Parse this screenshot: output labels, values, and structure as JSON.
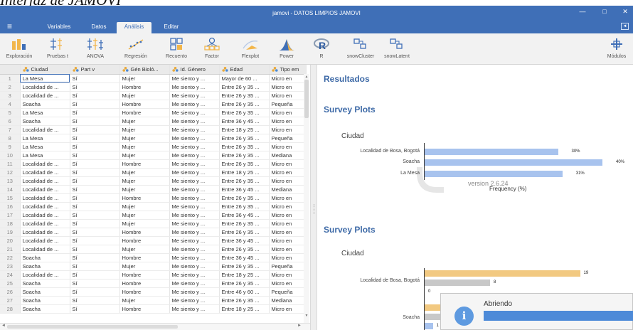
{
  "caption": "Interfaz de JAMOVI",
  "window": {
    "title": "jamovi - DATOS LIMPIOS JAMOVI",
    "minimize_glyph": "—",
    "maximize_glyph": "□",
    "close_glyph": "✕"
  },
  "menubar": {
    "menu_glyph": "≡",
    "tabs": [
      {
        "label": "Variables"
      },
      {
        "label": "Datos"
      },
      {
        "label": "Análisis"
      },
      {
        "label": "Editar"
      }
    ],
    "active_tab": "Análisis",
    "collapse_glyph": "◄"
  },
  "ribbon": {
    "buttons": [
      {
        "label": "Exploración",
        "icon": "exploration-icon"
      },
      {
        "label": "Pruebas t",
        "icon": "t-tests-icon"
      },
      {
        "label": "ANOVA",
        "icon": "anova-icon"
      },
      {
        "label": "Regresión",
        "icon": "regression-icon"
      },
      {
        "label": "Recuento",
        "icon": "frequencies-icon"
      },
      {
        "label": "Factor",
        "icon": "factor-icon"
      },
      {
        "label": "Flexplot",
        "icon": "flexplot-icon"
      },
      {
        "label": "Power",
        "icon": "power-icon"
      },
      {
        "label": "R",
        "icon": "r-icon"
      },
      {
        "label": "snowCluster",
        "icon": "snowcluster-icon"
      },
      {
        "label": "snowLatent",
        "icon": "snowlatent-icon"
      },
      {
        "label": "Módulos",
        "icon": "modules-icon"
      }
    ]
  },
  "colors": {
    "brand": "#3f6fb7",
    "bar_blue": "#a8c3ee",
    "bar_orange": "#f2c981",
    "bar_gray": "#c8c8c8",
    "header_blue": "#3e6aa7"
  },
  "table": {
    "columns": [
      "Ciudad",
      "Part v",
      "Gén Bioló...",
      "Id. Género",
      "Edad",
      "Tipo em"
    ],
    "rows": [
      {
        "n": "1",
        "cells": [
          "La Mesa",
          "Sí",
          "Mujer",
          "Me siento y ...",
          "Mayor de 60 ...",
          "Micro en"
        ]
      },
      {
        "n": "2",
        "cells": [
          "Localidad de ...",
          "Sí",
          "Hombre",
          "Me siento y ...",
          "Entre 26 y 35 ...",
          "Micro en"
        ]
      },
      {
        "n": "3",
        "cells": [
          "Localidad de ...",
          "Sí",
          "Mujer",
          "Me siento y ...",
          "Entre 26 y 35 ...",
          "Micro en"
        ]
      },
      {
        "n": "4",
        "cells": [
          "Soacha",
          "Sí",
          "Hombre",
          "Me siento y ...",
          "Entre 26 y 35 ...",
          "Pequeña"
        ]
      },
      {
        "n": "5",
        "cells": [
          "La Mesa",
          "Sí",
          "Hombre",
          "Me siento y ...",
          "Entre 26 y 35 ...",
          "Micro en"
        ]
      },
      {
        "n": "6",
        "cells": [
          "Soacha",
          "Sí",
          "Mujer",
          "Me siento y ...",
          "Entre 36 y 45 ...",
          "Micro en"
        ]
      },
      {
        "n": "7",
        "cells": [
          "Localidad de ...",
          "Sí",
          "Mujer",
          "Me siento y ...",
          "Entre 18 y 25 ...",
          "Micro en"
        ]
      },
      {
        "n": "8",
        "cells": [
          "La Mesa",
          "Sí",
          "Mujer",
          "Me siento y ...",
          "Entre 26 y 35 ...",
          "Pequeña"
        ]
      },
      {
        "n": "9",
        "cells": [
          "La Mesa",
          "Sí",
          "Mujer",
          "Me siento y ...",
          "Entre 26 y 35 ...",
          "Micro en"
        ]
      },
      {
        "n": "10",
        "cells": [
          "La Mesa",
          "Sí",
          "Mujer",
          "Me siento y ...",
          "Entre 26 y 35 ...",
          "Mediana"
        ]
      },
      {
        "n": "11",
        "cells": [
          "Localidad de ...",
          "Sí",
          "Hombre",
          "Me siento y ...",
          "Entre 26 y 35 ...",
          "Micro en"
        ]
      },
      {
        "n": "12",
        "cells": [
          "Localidad de ...",
          "Sí",
          "Mujer",
          "Me siento y ...",
          "Entre 18 y 25 ...",
          "Micro en"
        ]
      },
      {
        "n": "13",
        "cells": [
          "Localidad de ...",
          "Sí",
          "Mujer",
          "Me siento y ...",
          "Entre 26 y 35 ...",
          "Micro en"
        ]
      },
      {
        "n": "14",
        "cells": [
          "Localidad de ...",
          "Sí",
          "Mujer",
          "Me siento y ...",
          "Entre 36 y 45 ...",
          "Mediana"
        ]
      },
      {
        "n": "15",
        "cells": [
          "Localidad de ...",
          "Sí",
          "Hombre",
          "Me siento y ...",
          "Entre 26 y 35 ...",
          "Micro en"
        ]
      },
      {
        "n": "16",
        "cells": [
          "Localidad de ...",
          "Sí",
          "Mujer",
          "Me siento y ...",
          "Entre 26 y 35 ...",
          "Micro en"
        ]
      },
      {
        "n": "17",
        "cells": [
          "Localidad de ...",
          "Sí",
          "Mujer",
          "Me siento y ...",
          "Entre 36 y 45 ...",
          "Micro en"
        ]
      },
      {
        "n": "18",
        "cells": [
          "Localidad de ...",
          "Sí",
          "Mujer",
          "Me siento y ...",
          "Entre 26 y 35 ...",
          "Micro en"
        ]
      },
      {
        "n": "19",
        "cells": [
          "Localidad de ...",
          "Sí",
          "Hombre",
          "Me siento y ...",
          "Entre 26 y 35 ...",
          "Micro en"
        ]
      },
      {
        "n": "20",
        "cells": [
          "Localidad de ...",
          "Sí",
          "Hombre",
          "Me siento y ...",
          "Entre 36 y 45 ...",
          "Micro en"
        ]
      },
      {
        "n": "21",
        "cells": [
          "Localidad de ...",
          "Sí",
          "Mujer",
          "Me siento y ...",
          "Entre 26 y 35 ...",
          "Micro en"
        ]
      },
      {
        "n": "22",
        "cells": [
          "Soacha",
          "Sí",
          "Hombre",
          "Me siento y ...",
          "Entre 36 y 45 ...",
          "Micro en"
        ]
      },
      {
        "n": "23",
        "cells": [
          "Soacha",
          "Sí",
          "Mujer",
          "Me siento y ...",
          "Entre 26 y 35 ...",
          "Pequeña"
        ]
      },
      {
        "n": "24",
        "cells": [
          "Localidad de ...",
          "Sí",
          "Hombre",
          "Me siento y ...",
          "Entre 18 y 25 ...",
          "Micro en"
        ]
      },
      {
        "n": "25",
        "cells": [
          "Soacha",
          "Sí",
          "Hombre",
          "Me siento y ...",
          "Entre 26 y 35 ...",
          "Micro en"
        ]
      },
      {
        "n": "26",
        "cells": [
          "Soacha",
          "Sí",
          "Hombre",
          "Me siento y ...",
          "Entre 46 y 60 ...",
          "Pequeña"
        ]
      },
      {
        "n": "27",
        "cells": [
          "Soacha",
          "Sí",
          "Mujer",
          "Me siento y ...",
          "Entre 26 y 35 ...",
          "Mediana"
        ]
      },
      {
        "n": "28",
        "cells": [
          "Soacha",
          "Sí",
          "Hombre",
          "Me siento y ...",
          "Entre 18 y 25 ...",
          "Micro en"
        ]
      }
    ]
  },
  "results": {
    "heading": "Resultados",
    "sections": [
      {
        "heading": "Survey Plots"
      },
      {
        "heading": "Survey Plots"
      }
    ]
  },
  "chart_data": [
    {
      "type": "bar",
      "orientation": "horizontal",
      "title": "Ciudad",
      "categories": [
        "Localidad de Bosa, Bogotá",
        "Soacha",
        "La Mesa"
      ],
      "values": [
        30,
        40,
        31
      ],
      "value_labels": [
        "30%",
        "40%",
        "31%"
      ],
      "xlabel": "Frequency (%)",
      "watermark": "version 2.6.24"
    },
    {
      "type": "bar",
      "orientation": "horizontal",
      "title": "Ciudad",
      "categories": [
        "Localidad de Bosa, Bogotá",
        "Soacha"
      ],
      "series": [
        {
          "values": [
            19,
            null
          ]
        },
        {
          "values": [
            8,
            null
          ]
        },
        {
          "values": [
            0,
            1
          ]
        }
      ],
      "value_labels": [
        "19",
        "8",
        "0",
        "1"
      ],
      "partially_hidden": true
    }
  ],
  "toast": {
    "info_glyph": "i",
    "message": "Abriendo",
    "progress": 1.0
  }
}
